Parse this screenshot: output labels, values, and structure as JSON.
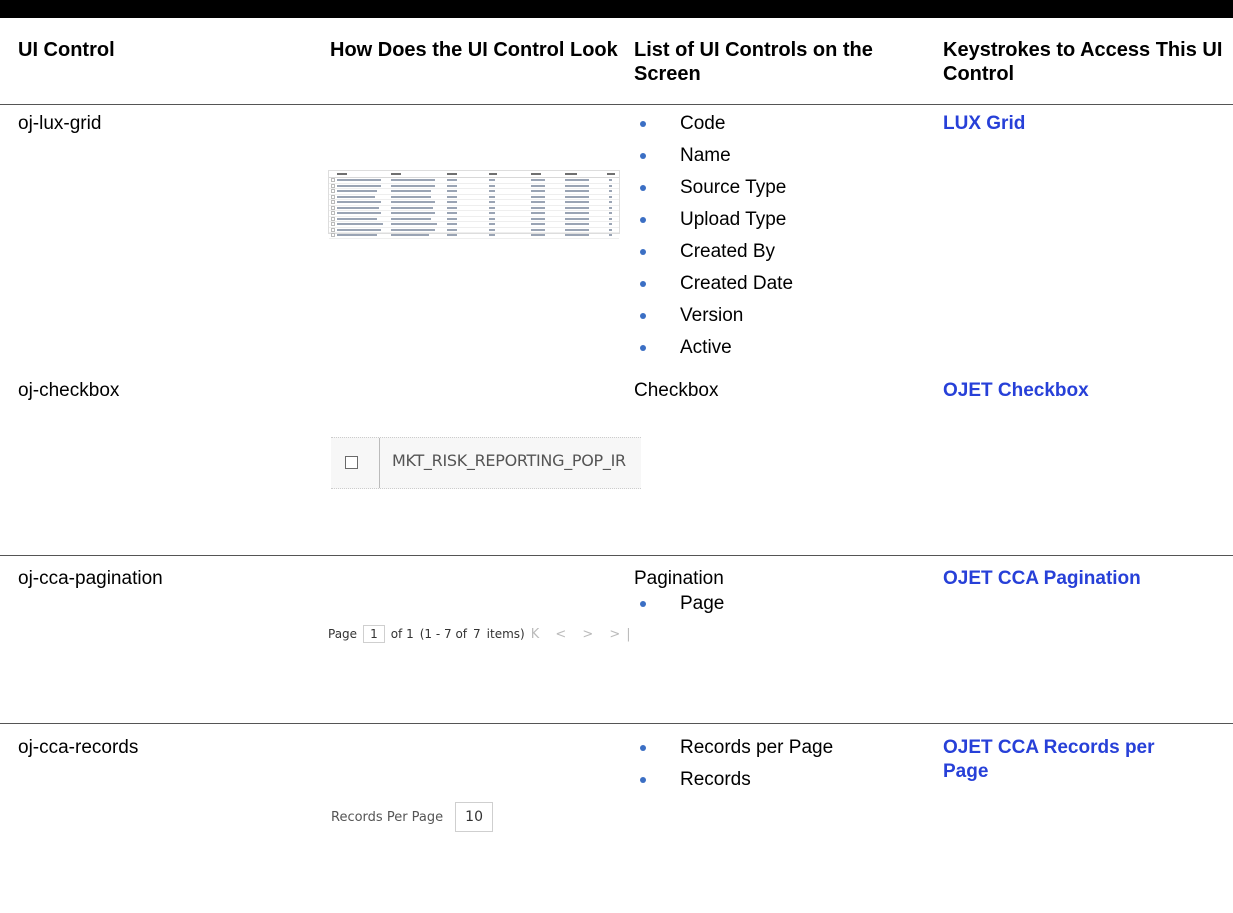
{
  "headers": {
    "col1": "UI Control",
    "col2": "How Does the UI Control Look",
    "col3": "List of UI Controls on the Screen",
    "col4": "Keystrokes to Access This UI Control"
  },
  "rows": [
    {
      "control": "oj-lux-grid",
      "items": [
        "Code",
        "Name",
        "Source Type",
        "Upload Type",
        "Created By",
        "Created Date",
        "Version",
        "Active"
      ],
      "link": "LUX Grid"
    },
    {
      "control": "oj-checkbox",
      "list_title": "Checkbox",
      "preview_label": "MKT_RISK_REPORTING_POP_IR",
      "link": "OJET Checkbox"
    },
    {
      "control": "oj-cca-pagination",
      "list_title": "Pagination",
      "items": [
        "Page"
      ],
      "preview": {
        "page_label": "Page",
        "page_value": "1",
        "of_label": "of 1",
        "range": "(1 - 7 of",
        "total": "7",
        "items_label": "items)",
        "arrows": "K < > >|"
      },
      "link": "OJET CCA Pagination"
    },
    {
      "control": "oj-cca-records",
      "items": [
        "Records per Page",
        "Records"
      ],
      "preview": {
        "label": "Records Per Page",
        "value": "10"
      },
      "link_line1": "OJET CCA Records per",
      "link_line2": "Page"
    }
  ]
}
